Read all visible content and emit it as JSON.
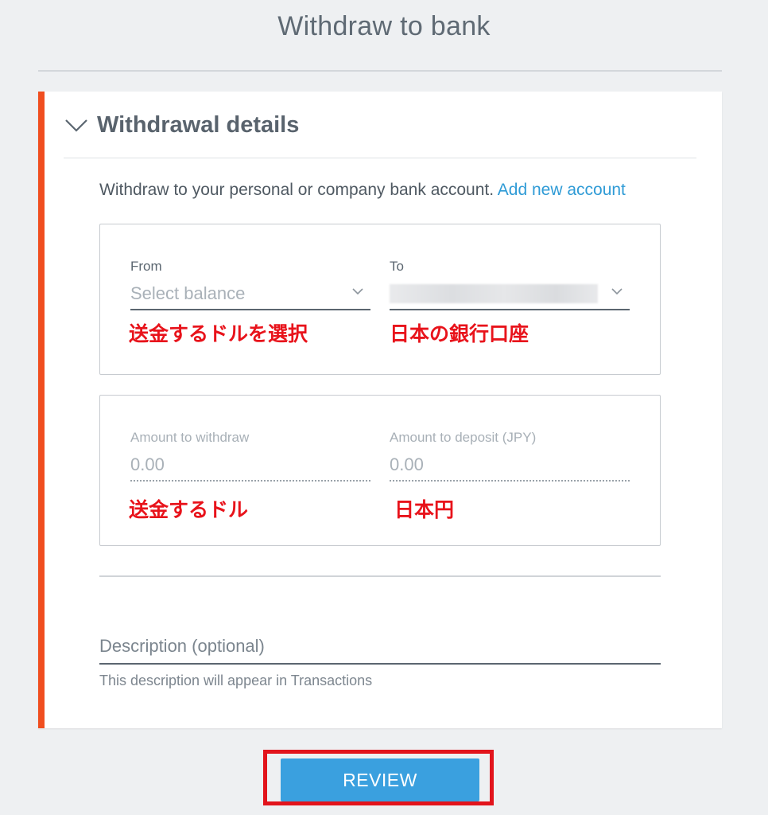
{
  "page": {
    "title": "Withdraw to bank"
  },
  "section": {
    "title": "Withdrawal details",
    "intro_text": "Withdraw to your personal or company bank account.",
    "add_account_link": "Add new account"
  },
  "from_field": {
    "label": "From",
    "placeholder": "Select balance"
  },
  "to_field": {
    "label": "To"
  },
  "amount_withdraw": {
    "label": "Amount to withdraw",
    "value": "0.00"
  },
  "amount_deposit": {
    "label": "Amount to deposit (JPY)",
    "value": "0.00"
  },
  "description": {
    "placeholder": "Description (optional)",
    "help_text": "This description will appear in Transactions"
  },
  "annotations": {
    "from_note": "送金するドルを選択",
    "to_note": "日本の銀行口座",
    "withdraw_note": "送金するドル",
    "deposit_note": "日本円"
  },
  "review_button": {
    "label": "REVIEW"
  },
  "icons": {
    "section_toggle": "chevron-down-icon",
    "from_dropdown": "chevron-down-icon",
    "to_dropdown": "chevron-down-icon"
  },
  "colors": {
    "accent": "#f04e1f",
    "link": "#2f9bd6",
    "button": "#3aa0df",
    "annotation": "#e8131b"
  }
}
